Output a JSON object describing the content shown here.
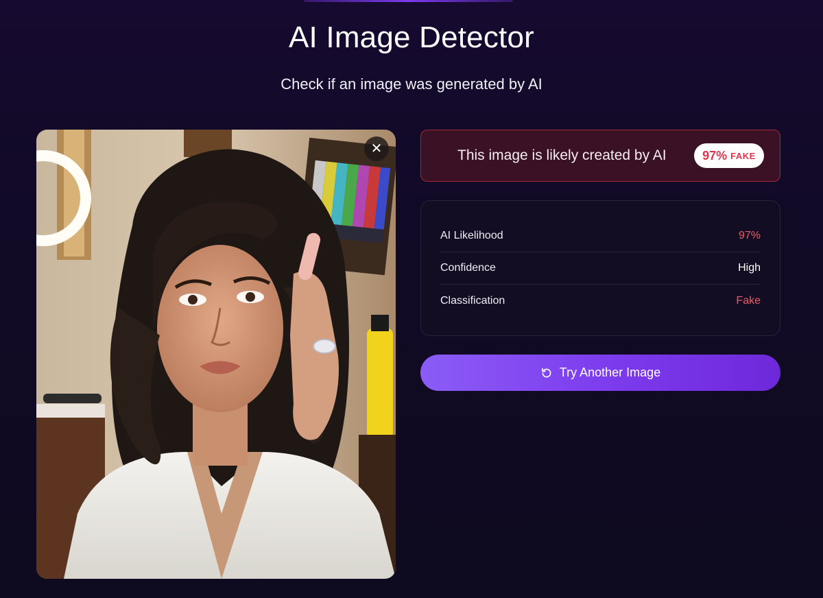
{
  "header": {
    "title": "AI Image Detector",
    "subtitle": "Check if an image was generated by AI"
  },
  "image_panel": {
    "close_glyph": "✕",
    "close_icon": "close-icon"
  },
  "verdict": {
    "text": "This image is likely created by AI",
    "badge_percent": "97%",
    "badge_label": "FAKE"
  },
  "stats": [
    {
      "label": "AI Likelihood",
      "value": "97%",
      "tone": "red"
    },
    {
      "label": "Confidence",
      "value": "High",
      "tone": "white"
    },
    {
      "label": "Classification",
      "value": "Fake",
      "tone": "red"
    }
  ],
  "actions": {
    "try_another_label": "Try Another Image",
    "try_another_icon": "refresh-icon"
  },
  "colors": {
    "accent": "#7c3aed",
    "fake_red": "#e0364d",
    "value_red": "#ef5a6a",
    "background": "#110a26"
  }
}
